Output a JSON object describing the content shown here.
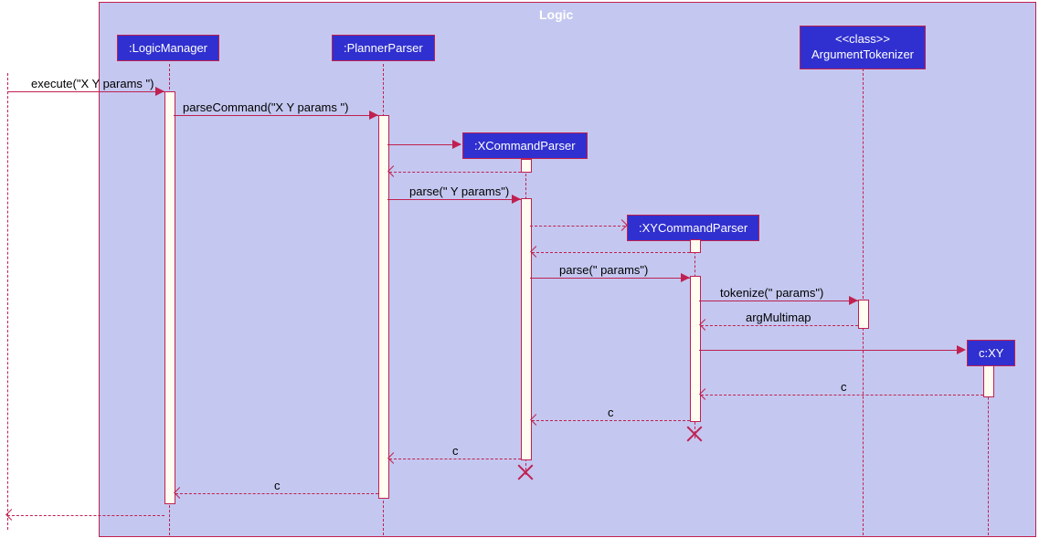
{
  "frame": {
    "title": "Logic"
  },
  "actors": {
    "logic_manager": ":LogicManager",
    "planner_parser": ":PlannerParser",
    "xcommand_parser": ":XCommandParser",
    "xycommand_parser": ":XYCommandParser",
    "argument_tokenizer": "<<class>>\nArgumentTokenizer",
    "cxy": "c:XY"
  },
  "messages": {
    "execute": "execute(\"X Y params \")",
    "parseCommand": "parseCommand(\"X Y params \")",
    "parseY": "parse(\" Y params\")",
    "parseParams": "parse(\" params\")",
    "tokenize": "tokenize(\" params\")",
    "argMultimap": "argMultimap",
    "c1": "c",
    "c2": "c",
    "c3": "c",
    "c4": "c"
  }
}
